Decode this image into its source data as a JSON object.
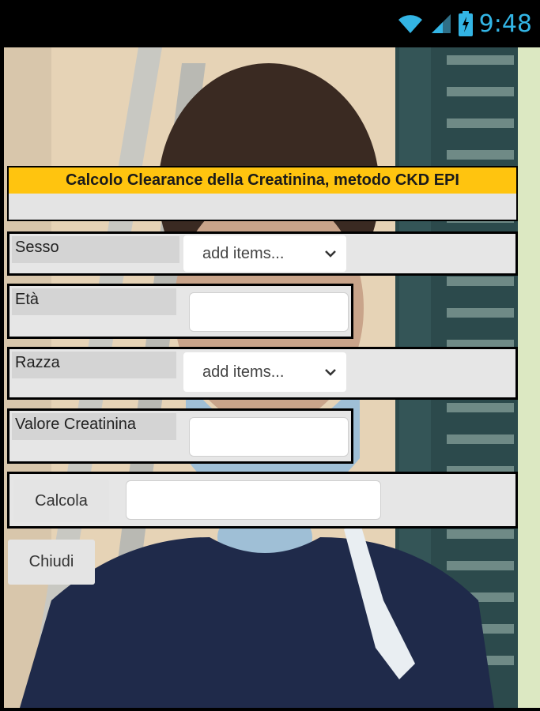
{
  "status": {
    "time": "9:48"
  },
  "app": {
    "title": "Calcolo Clearance della Creatinina, metodo CKD EPI"
  },
  "form": {
    "sex": {
      "label": "Sesso",
      "value": "add items..."
    },
    "age": {
      "label": "Età",
      "value": ""
    },
    "race": {
      "label": "Razza",
      "value": "add items..."
    },
    "creatinine": {
      "label": "Valore Creatinina",
      "value": ""
    },
    "calc": {
      "label": "Calcola",
      "result": ""
    },
    "close": {
      "label": "Chiudi"
    }
  },
  "colors": {
    "title_bar": "#ffc40f",
    "status_accent": "#33b5e5",
    "row_border": "#000000"
  }
}
